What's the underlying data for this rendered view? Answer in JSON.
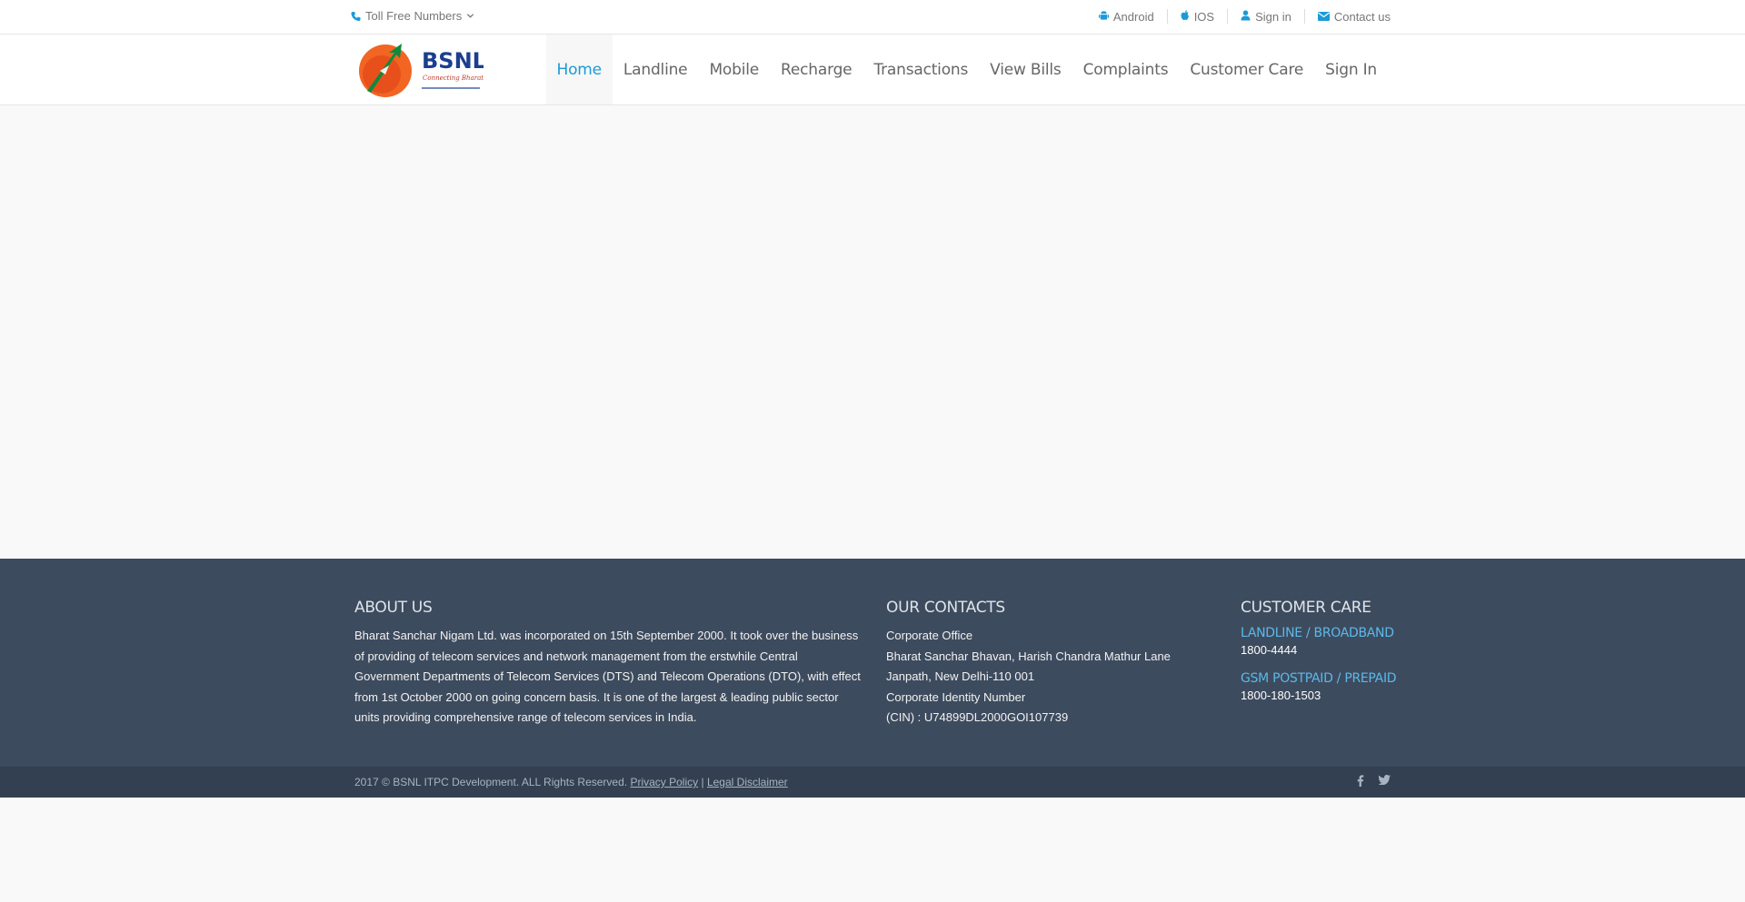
{
  "topbar": {
    "toll_free": "Toll Free Numbers",
    "links": [
      {
        "label": "Android",
        "icon": "android-icon"
      },
      {
        "label": "IOS",
        "icon": "apple-icon"
      },
      {
        "label": "Sign in",
        "icon": "user-icon"
      },
      {
        "label": "Contact us",
        "icon": "envelope-icon"
      }
    ]
  },
  "header": {
    "logo_text": "BSNL",
    "logo_tagline": "Connecting Bharat",
    "nav": [
      "Home",
      "Landline",
      "Mobile",
      "Recharge",
      "Transactions",
      "View Bills",
      "Complaints",
      "Customer Care",
      "Sign In"
    ],
    "active_nav": "Home"
  },
  "footer": {
    "about": {
      "title": "ABOUT US",
      "text": "Bharat Sanchar Nigam Ltd. was incorporated on 15th September 2000. It took over the business of providing of telecom services and network management from the erstwhile Central Government Departments of Telecom Services (DTS) and Telecom Operations (DTO), with effect from 1st October 2000 on going concern basis. It is one of the largest & leading public sector units providing comprehensive range of telecom services in India."
    },
    "contacts": {
      "title": "OUR CONTACTS",
      "lines": [
        "Corporate Office",
        "Bharat Sanchar Bhavan, Harish Chandra Mathur Lane",
        "Janpath, New Delhi-110 001",
        "Corporate Identity Number",
        "(CIN) : U74899DL2000GOI107739"
      ]
    },
    "care": {
      "title": "CUSTOMER CARE",
      "landline_label": "LANDLINE / BROADBAND",
      "landline_number": "1800-4444",
      "gsm_label": "GSM POSTPAID / PREPAID",
      "gsm_number": "1800-180-1503"
    }
  },
  "subfooter": {
    "copyright": "2017 © BSNL ITPC Development. ALL Rights Reserved.",
    "privacy": "Privacy Policy",
    "separator": "|",
    "legal": "Legal Disclaimer"
  },
  "colors": {
    "accent": "#1a9bd7",
    "footer_bg": "#3d4b5e",
    "subfooter_bg": "#334051",
    "care_label": "#5ab9ea"
  }
}
